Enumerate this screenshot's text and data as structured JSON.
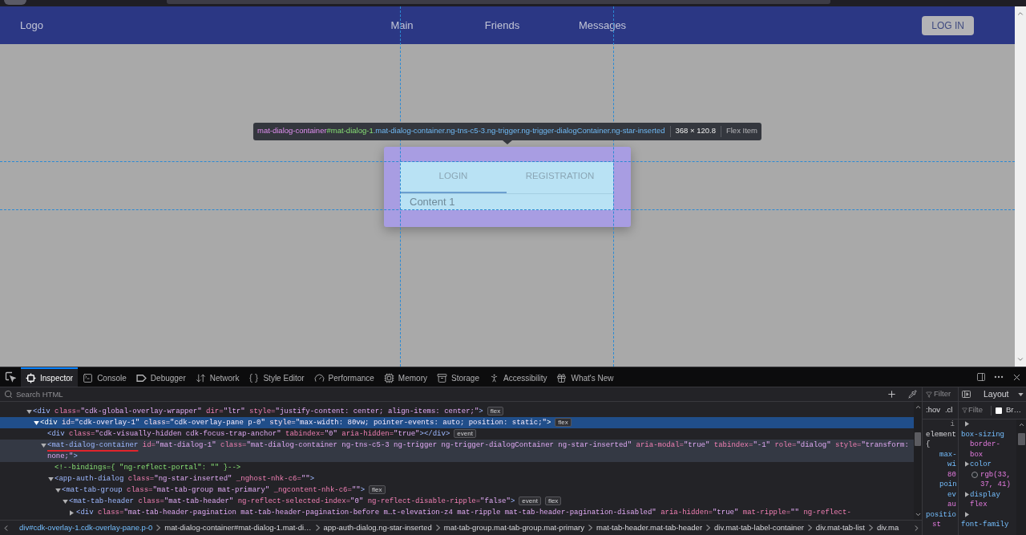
{
  "navbar": {
    "logo": "Logo",
    "links": [
      {
        "label": "Main"
      },
      {
        "label": "Friends"
      },
      {
        "label": "Messages"
      }
    ],
    "login_button": "LOG IN"
  },
  "highlighter": {
    "tag": "mat-dialog-container",
    "id": "#mat-dialog-1",
    "classes": ".mat-dialog-container.ng-tns-c5-3.ng-trigger.ng-trigger-dialogContainer.ng-star-inserted",
    "size": "368 × 120.8",
    "layout_type": "Flex Item"
  },
  "dialog": {
    "tabs": [
      {
        "label": "LOGIN",
        "selected": true
      },
      {
        "label": "REGISTRATION",
        "selected": false
      }
    ],
    "content": "Content 1"
  },
  "devtools": {
    "tabs": [
      {
        "kind": "inspector",
        "label": "Inspector",
        "selected": true
      },
      {
        "kind": "console",
        "label": "Console",
        "selected": false
      },
      {
        "kind": "debugger",
        "label": "Debugger",
        "selected": false
      },
      {
        "kind": "network",
        "label": "Network",
        "selected": false
      },
      {
        "kind": "style-editor",
        "label": "Style Editor",
        "selected": false
      },
      {
        "kind": "performance",
        "label": "Performance",
        "selected": false
      },
      {
        "kind": "memory",
        "label": "Memory",
        "selected": false
      },
      {
        "kind": "storage",
        "label": "Storage",
        "selected": false
      },
      {
        "kind": "accessibility",
        "label": "Accessibility",
        "selected": false
      },
      {
        "kind": "whats-new",
        "label": "What's New",
        "selected": false
      }
    ],
    "search": {
      "placeholder": "Search HTML"
    },
    "markup_tree": [
      {
        "lines": [
          [
            {
              "kind": "tag",
              "text": "<div"
            },
            {
              "kind": "attr",
              "text": " class="
            },
            {
              "kind": "value",
              "text": "\"cdk-global-overlay-wrapper\""
            },
            {
              "kind": "attr",
              "text": " dir="
            },
            {
              "kind": "value",
              "text": "\"ltr\""
            },
            {
              "kind": "attr",
              "text": " style="
            },
            {
              "kind": "value",
              "text": "\"justify-content: center; align-items: center;\""
            },
            {
              "kind": "tag",
              "text": ">"
            }
          ]
        ],
        "badges": [
          "flex"
        ],
        "expanded": true,
        "selected": false,
        "hovered": false,
        "children": [
          {
            "lines": [
              [
                {
                  "kind": "tag",
                  "text": "<div"
                },
                {
                  "kind": "attr",
                  "text": " id="
                },
                {
                  "kind": "value",
                  "text": "\"cdk-overlay-1\""
                },
                {
                  "kind": "attr",
                  "text": " class="
                },
                {
                  "kind": "value",
                  "text": "\"cdk-overlay-pane p-0\""
                },
                {
                  "kind": "attr",
                  "text": " style="
                },
                {
                  "kind": "value",
                  "text": "\"max-width: 80vw; pointer-events: auto; position: static;\""
                },
                {
                  "kind": "tag",
                  "text": ">"
                }
              ]
            ],
            "badges": [
              "flex"
            ],
            "expanded": true,
            "selected": true,
            "hovered": false,
            "children": [
              {
                "lines": [
                  [
                    {
                      "kind": "tag",
                      "text": "<div"
                    },
                    {
                      "kind": "attr",
                      "text": " class="
                    },
                    {
                      "kind": "value",
                      "text": "\"cdk-visually-hidden cdk-focus-trap-anchor\""
                    },
                    {
                      "kind": "attr",
                      "text": " tabindex="
                    },
                    {
                      "kind": "value",
                      "text": "\"0\""
                    },
                    {
                      "kind": "attr",
                      "text": " aria-hidden="
                    },
                    {
                      "kind": "value",
                      "text": "\"true\""
                    },
                    {
                      "kind": "tag",
                      "text": "></div>"
                    }
                  ]
                ],
                "badges": [
                  "event"
                ],
                "selected": false,
                "hovered": false
              },
              {
                "lines": [
                  [
                    {
                      "kind": "tag",
                      "text": "<mat-dialog-container",
                      "underlined": true
                    },
                    {
                      "kind": "attr",
                      "text": " id="
                    },
                    {
                      "kind": "value",
                      "text": "\"mat-dialog-1\""
                    },
                    {
                      "kind": "attr",
                      "text": " class="
                    },
                    {
                      "kind": "value",
                      "text": "\"mat-dialog-container ng-tns-c5-3 ng-trigger ng-trigger-dialogContainer ng-star-inserted\""
                    },
                    {
                      "kind": "attr",
                      "text": " aria-modal="
                    },
                    {
                      "kind": "value",
                      "text": "\"true\""
                    },
                    {
                      "kind": "attr",
                      "text": " tabindex="
                    },
                    {
                      "kind": "value",
                      "text": "\"-1\""
                    },
                    {
                      "kind": "attr",
                      "text": " role="
                    },
                    {
                      "kind": "value",
                      "text": "\"dialog\""
                    },
                    {
                      "kind": "attr",
                      "text": " style="
                    },
                    {
                      "kind": "value",
                      "text": "\"transform:"
                    }
                  ],
                  [
                    {
                      "kind": "value",
                      "text": "none;\""
                    },
                    {
                      "kind": "tag",
                      "text": ">"
                    }
                  ]
                ],
                "expanded": true,
                "selected": false,
                "hovered": true,
                "children": [
                  {
                    "lines": [
                      [
                        {
                          "kind": "comment",
                          "text": "<!--bindings={ \"ng-reflect-portal\": \"\" }-->"
                        }
                      ]
                    ],
                    "selected": false,
                    "hovered": false
                  },
                  {
                    "lines": [
                      [
                        {
                          "kind": "tag",
                          "text": "<app-auth-dialog"
                        },
                        {
                          "kind": "attr",
                          "text": " class="
                        },
                        {
                          "kind": "value",
                          "text": "\"ng-star-inserted\""
                        },
                        {
                          "kind": "attr",
                          "text": " _nghost-nhk-c6="
                        },
                        {
                          "kind": "value",
                          "text": "\"\""
                        },
                        {
                          "kind": "tag",
                          "text": ">"
                        }
                      ]
                    ],
                    "expanded": true,
                    "selected": false,
                    "hovered": false,
                    "children": [
                      {
                        "lines": [
                          [
                            {
                              "kind": "tag",
                              "text": "<mat-tab-group"
                            },
                            {
                              "kind": "attr",
                              "text": " class="
                            },
                            {
                              "kind": "value",
                              "text": "\"mat-tab-group mat-primary\""
                            },
                            {
                              "kind": "attr",
                              "text": " _ngcontent-nhk-c6="
                            },
                            {
                              "kind": "value",
                              "text": "\"\""
                            },
                            {
                              "kind": "tag",
                              "text": ">"
                            }
                          ]
                        ],
                        "badges": [
                          "flex"
                        ],
                        "expanded": true,
                        "selected": false,
                        "hovered": false,
                        "children": [
                          {
                            "lines": [
                              [
                                {
                                  "kind": "tag",
                                  "text": "<mat-tab-header"
                                },
                                {
                                  "kind": "attr",
                                  "text": " class="
                                },
                                {
                                  "kind": "value",
                                  "text": "\"mat-tab-header\""
                                },
                                {
                                  "kind": "attr",
                                  "text": " ng-reflect-selected-index="
                                },
                                {
                                  "kind": "value",
                                  "text": "\"0\""
                                },
                                {
                                  "kind": "attr",
                                  "text": " ng-reflect-disable-ripple="
                                },
                                {
                                  "kind": "value",
                                  "text": "\"false\""
                                },
                                {
                                  "kind": "tag",
                                  "text": ">"
                                }
                              ]
                            ],
                            "badges": [
                              "event",
                              "flex"
                            ],
                            "expanded": true,
                            "selected": false,
                            "hovered": false,
                            "children": [
                              {
                                "lines": [
                                  [
                                    {
                                      "kind": "tag",
                                      "text": "<div"
                                    },
                                    {
                                      "kind": "attr",
                                      "text": " class="
                                    },
                                    {
                                      "kind": "value",
                                      "text": "\"mat-tab-header-pagination mat-tab-header-pagination-before m…t-elevation-z4 mat-ripple mat-tab-header-pagination-disabled\""
                                    },
                                    {
                                      "kind": "attr",
                                      "text": " aria-hidden="
                                    },
                                    {
                                      "kind": "value",
                                      "text": "\"true\""
                                    },
                                    {
                                      "kind": "attr",
                                      "text": " mat-ripple="
                                    },
                                    {
                                      "kind": "value",
                                      "text": "\"\""
                                    },
                                    {
                                      "kind": "attr",
                                      "text": " ng-reflect-"
                                    }
                                  ]
                                ],
                                "expanded": false,
                                "selected": false,
                                "hovered": false
                              }
                            ]
                          }
                        ]
                      }
                    ]
                  }
                ]
              }
            ]
          }
        ]
      }
    ],
    "breadcrumbs": [
      {
        "label": "div#cdk-overlay-1.cdk-overlay-pane.p-0",
        "selected": true
      },
      {
        "label": "mat-dialog-container#mat-dialog-1.mat-di…",
        "selected": false
      },
      {
        "label": "app-auth-dialog.ng-star-inserted",
        "selected": false
      },
      {
        "label": "mat-tab-group.mat-tab-group.mat-primary",
        "selected": false
      },
      {
        "label": "mat-tab-header.mat-tab-header",
        "selected": false
      },
      {
        "label": "div.mat-tab-label-container",
        "selected": false
      },
      {
        "label": "div.mat-tab-list",
        "selected": false
      },
      {
        "label": "div.ma",
        "selected": false
      }
    ],
    "rules": {
      "filter_placeholder": "Filter",
      "pseudo_toggle": ":hov",
      "class_toggle": ".cl",
      "lines": [
        {
          "kind": "source",
          "text": "i"
        },
        {
          "kind": "selector",
          "text": "element"
        },
        {
          "kind": "brace",
          "text": "{"
        },
        {
          "kind": "property",
          "text": "max-"
        },
        {
          "kind": "property-wrap",
          "text": "wi"
        },
        {
          "kind": "value",
          "text": "80"
        },
        {
          "kind": "property",
          "text": "poin"
        },
        {
          "kind": "property-wrap",
          "text": "ev"
        },
        {
          "kind": "value",
          "text": "au"
        },
        {
          "kind": "outer-property",
          "text": "positio"
        },
        {
          "kind": "outer-value",
          "text": "st"
        }
      ]
    },
    "layout": {
      "tab": "Layout",
      "filter_placeholder": "Filte",
      "browser_styles": {
        "label": "Br…",
        "checked": false
      },
      "properties": [
        {
          "name": "box-sizing",
          "value": "border-box",
          "expanded": false
        },
        {
          "name": "color",
          "value": "rgb(33, 37, 41)",
          "swatch": true,
          "expanded": false
        },
        {
          "name": "display",
          "value": "flex",
          "expanded": false
        },
        {
          "name": "font-family",
          "expanded": false
        }
      ]
    }
  }
}
